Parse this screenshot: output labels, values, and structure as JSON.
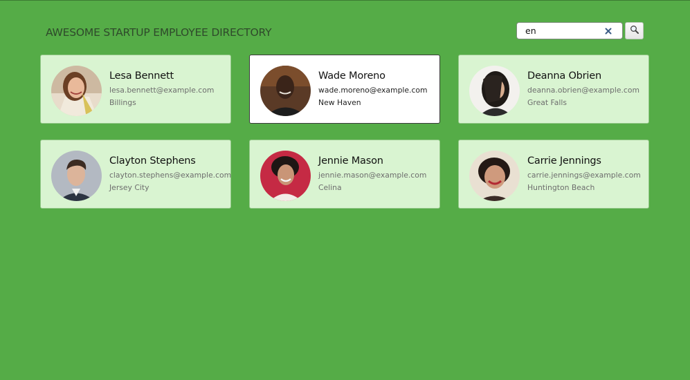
{
  "header": {
    "title": "AWESOME STARTUP EMPLOYEE DIRECTORY"
  },
  "search": {
    "value": "en",
    "button_icon": "magnifier-icon",
    "clear_icon": "close-icon"
  },
  "colors": {
    "background": "#55ac47",
    "card": "#d9f4d1",
    "card_active": "#ffffff"
  },
  "employees": [
    {
      "name": "Lesa Bennett",
      "email": "lesa.bennett@example.com",
      "city": "Billings",
      "avatar": "avatar-photo"
    },
    {
      "name": "Wade Moreno",
      "email": "wade.moreno@example.com",
      "city": "New Haven",
      "avatar": "avatar-photo"
    },
    {
      "name": "Deanna Obrien",
      "email": "deanna.obrien@example.com",
      "city": "Great Falls",
      "avatar": "avatar-photo"
    },
    {
      "name": "Clayton Stephens",
      "email": "clayton.stephens@example.com",
      "city": "Jersey City",
      "avatar": "avatar-photo"
    },
    {
      "name": "Jennie Mason",
      "email": "jennie.mason@example.com",
      "city": "Celina",
      "avatar": "avatar-photo"
    },
    {
      "name": "Carrie Jennings",
      "email": "carrie.jennings@example.com",
      "city": "Huntington Beach",
      "avatar": "avatar-photo"
    }
  ]
}
